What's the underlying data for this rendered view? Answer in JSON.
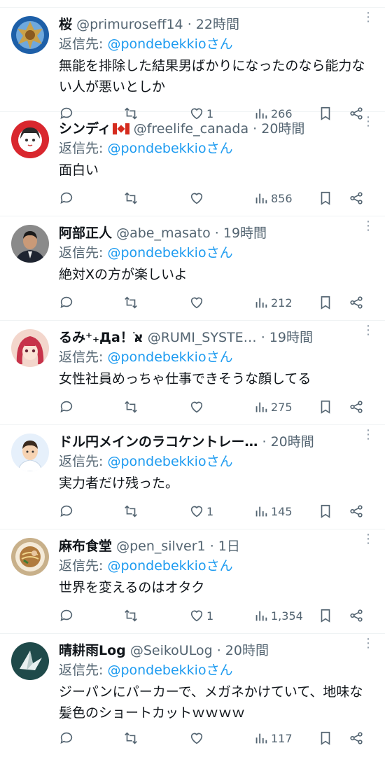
{
  "reply_to_label": "返信先:",
  "replies": [
    {
      "name": "桜",
      "handle": "@primuroseff14",
      "sep": "·",
      "time": "22時間",
      "reply_to": "@pondebekkioさん",
      "text": "無能を排除した結果男ばかりになったのなら能力ない人が悪いとしか",
      "likes": "1",
      "views": "266",
      "avatar": {
        "icon": "golden-emblem-avatar",
        "bg": "#1d5fa8"
      }
    },
    {
      "name": "シンディ",
      "handle": "@freelife_canada",
      "sep": "·",
      "time": "20時間",
      "reply_to": "@pondebekkioさん",
      "text": "面白い",
      "likes": "",
      "views": "856",
      "avatar": {
        "icon": "anime-girl-avatar",
        "bg": "#d9272e"
      }
    },
    {
      "name": "阿部正人",
      "handle": "@abe_masato",
      "sep": "·",
      "time": "19時間",
      "reply_to": "@pondebekkioさん",
      "text": "絶対Xの方が楽しいよ",
      "likes": "",
      "views": "212",
      "avatar": {
        "icon": "man-in-suit-avatar",
        "bg": "#4a4a4a"
      }
    },
    {
      "name": "るみ⁺₊Дa！אֹּ",
      "handle": "@RUMI_SYSTE…",
      "sep": "·",
      "time": "19時間",
      "reply_to": "@pondebekkioさん",
      "text": "女性社員めっちゃ仕事できそうな顔してる",
      "likes": "",
      "views": "275",
      "avatar": {
        "icon": "red-hair-anime-avatar",
        "bg": "#f3b8a8"
      }
    },
    {
      "name": "ドル円メインのラコケントレー…",
      "handle": "",
      "sep": "·",
      "time": "20時間",
      "reply_to": "@pondebekkioさん",
      "text": "実力者だけ残った。",
      "likes": "1",
      "views": "145",
      "avatar": {
        "icon": "cartoon-man-avatar",
        "bg": "#e6f0fb"
      }
    },
    {
      "name": "麻布食堂",
      "handle": "@pen_silver1",
      "sep": "·",
      "time": "1日",
      "reply_to": "@pondebekkioさん",
      "text": "世界を変えるのはオタク",
      "likes": "1",
      "views": "1,354",
      "avatar": {
        "icon": "ramen-bowl-avatar",
        "bg": "#c8b08a"
      }
    },
    {
      "name": "晴耕雨Log",
      "handle": "@SeikoULog",
      "sep": "·",
      "time": "20時間",
      "reply_to": "@pondebekkioさん",
      "text": "ジーパンにパーカーで、メガネかけていて、地味な髪色のショートカットｗｗｗｗ",
      "likes": "",
      "views": "117",
      "avatar": {
        "icon": "paper-crane-avatar",
        "bg": "#1f4a4a"
      }
    }
  ],
  "colors": {
    "link": "#1d9bf0",
    "secondary": "#536471",
    "divider": "#eff3f4"
  }
}
